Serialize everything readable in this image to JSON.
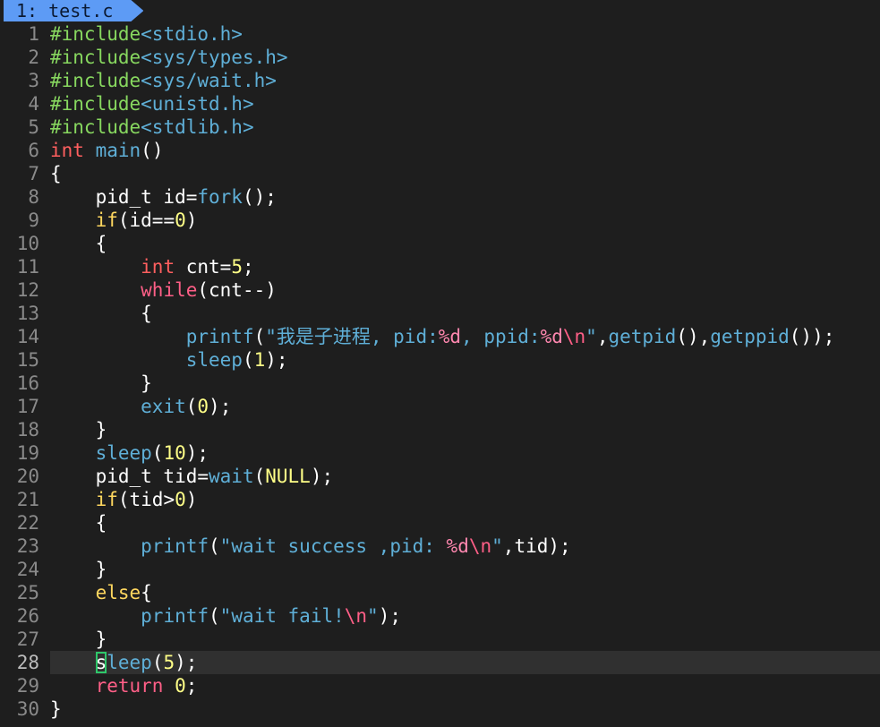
{
  "tab": {
    "number": "1:",
    "filename": "test.c"
  },
  "cursor_line": 28,
  "lines": [
    {
      "n": "1",
      "tokens": [
        {
          "t": "#include",
          "c": "pre"
        },
        {
          "t": "<stdio.h>",
          "c": "inc"
        }
      ]
    },
    {
      "n": "2",
      "tokens": [
        {
          "t": "#include",
          "c": "pre"
        },
        {
          "t": "<sys/types.h>",
          "c": "inc"
        }
      ]
    },
    {
      "n": "3",
      "tokens": [
        {
          "t": "#include",
          "c": "pre"
        },
        {
          "t": "<sys/wait.h>",
          "c": "inc"
        }
      ]
    },
    {
      "n": "4",
      "tokens": [
        {
          "t": "#include",
          "c": "pre"
        },
        {
          "t": "<unistd.h>",
          "c": "inc"
        }
      ]
    },
    {
      "n": "5",
      "tokens": [
        {
          "t": "#include",
          "c": "pre"
        },
        {
          "t": "<stdlib.h>",
          "c": "inc"
        }
      ]
    },
    {
      "n": "6",
      "tokens": [
        {
          "t": "int",
          "c": "type"
        },
        {
          "t": " ",
          "c": "text"
        },
        {
          "t": "main",
          "c": "func"
        },
        {
          "t": "()",
          "c": "text"
        }
      ]
    },
    {
      "n": "7",
      "tokens": [
        {
          "t": "{",
          "c": "text"
        }
      ]
    },
    {
      "n": "8",
      "tokens": [
        {
          "t": "    pid_t id=",
          "c": "text"
        },
        {
          "t": "fork",
          "c": "func"
        },
        {
          "t": "();",
          "c": "text"
        }
      ]
    },
    {
      "n": "9",
      "tokens": [
        {
          "t": "    ",
          "c": "text"
        },
        {
          "t": "if",
          "c": "kw"
        },
        {
          "t": "(id==",
          "c": "text"
        },
        {
          "t": "0",
          "c": "num"
        },
        {
          "t": ")",
          "c": "text"
        }
      ]
    },
    {
      "n": "10",
      "tokens": [
        {
          "t": "    {",
          "c": "text"
        }
      ]
    },
    {
      "n": "11",
      "tokens": [
        {
          "t": "        ",
          "c": "text"
        },
        {
          "t": "int",
          "c": "type"
        },
        {
          "t": " cnt=",
          "c": "text"
        },
        {
          "t": "5",
          "c": "num"
        },
        {
          "t": ";",
          "c": "text"
        }
      ]
    },
    {
      "n": "12",
      "tokens": [
        {
          "t": "        ",
          "c": "text"
        },
        {
          "t": "while",
          "c": "ret"
        },
        {
          "t": "(cnt--)",
          "c": "text"
        }
      ]
    },
    {
      "n": "13",
      "tokens": [
        {
          "t": "        {",
          "c": "text"
        }
      ]
    },
    {
      "n": "14",
      "tokens": [
        {
          "t": "            ",
          "c": "text"
        },
        {
          "t": "printf",
          "c": "func"
        },
        {
          "t": "(",
          "c": "text"
        },
        {
          "t": "\"我是子进程, pid:",
          "c": "str"
        },
        {
          "t": "%d",
          "c": "fmt"
        },
        {
          "t": ", ppid:",
          "c": "str"
        },
        {
          "t": "%d",
          "c": "fmt"
        },
        {
          "t": "\\n",
          "c": "esc"
        },
        {
          "t": "\"",
          "c": "str"
        },
        {
          "t": ",",
          "c": "text"
        },
        {
          "t": "getpid",
          "c": "func"
        },
        {
          "t": "(),",
          "c": "text"
        },
        {
          "t": "getppid",
          "c": "func"
        },
        {
          "t": "());",
          "c": "text"
        }
      ]
    },
    {
      "n": "15",
      "tokens": [
        {
          "t": "            ",
          "c": "text"
        },
        {
          "t": "sleep",
          "c": "func"
        },
        {
          "t": "(",
          "c": "text"
        },
        {
          "t": "1",
          "c": "num"
        },
        {
          "t": ");",
          "c": "text"
        }
      ]
    },
    {
      "n": "16",
      "tokens": [
        {
          "t": "        }",
          "c": "text"
        }
      ]
    },
    {
      "n": "17",
      "tokens": [
        {
          "t": "        ",
          "c": "text"
        },
        {
          "t": "exit",
          "c": "func"
        },
        {
          "t": "(",
          "c": "text"
        },
        {
          "t": "0",
          "c": "num"
        },
        {
          "t": ");",
          "c": "text"
        }
      ]
    },
    {
      "n": "18",
      "tokens": [
        {
          "t": "    }",
          "c": "text"
        }
      ]
    },
    {
      "n": "19",
      "tokens": [
        {
          "t": "    ",
          "c": "text"
        },
        {
          "t": "sleep",
          "c": "func"
        },
        {
          "t": "(",
          "c": "text"
        },
        {
          "t": "10",
          "c": "num"
        },
        {
          "t": ");",
          "c": "text"
        }
      ]
    },
    {
      "n": "20",
      "tokens": [
        {
          "t": "    pid_t tid=",
          "c": "text"
        },
        {
          "t": "wait",
          "c": "func"
        },
        {
          "t": "(",
          "c": "text"
        },
        {
          "t": "NULL",
          "c": "num"
        },
        {
          "t": ");",
          "c": "text"
        }
      ]
    },
    {
      "n": "21",
      "tokens": [
        {
          "t": "    ",
          "c": "text"
        },
        {
          "t": "if",
          "c": "kw"
        },
        {
          "t": "(tid>",
          "c": "text"
        },
        {
          "t": "0",
          "c": "num"
        },
        {
          "t": ")",
          "c": "text"
        }
      ]
    },
    {
      "n": "22",
      "tokens": [
        {
          "t": "    {",
          "c": "text"
        }
      ]
    },
    {
      "n": "23",
      "tokens": [
        {
          "t": "        ",
          "c": "text"
        },
        {
          "t": "printf",
          "c": "func"
        },
        {
          "t": "(",
          "c": "text"
        },
        {
          "t": "\"wait success ,pid: ",
          "c": "str"
        },
        {
          "t": "%d",
          "c": "fmt"
        },
        {
          "t": "\\n",
          "c": "esc"
        },
        {
          "t": "\"",
          "c": "str"
        },
        {
          "t": ",tid);",
          "c": "text"
        }
      ]
    },
    {
      "n": "24",
      "tokens": [
        {
          "t": "    }",
          "c": "text"
        }
      ]
    },
    {
      "n": "25",
      "tokens": [
        {
          "t": "    ",
          "c": "text"
        },
        {
          "t": "else",
          "c": "kw"
        },
        {
          "t": "{",
          "c": "text"
        }
      ]
    },
    {
      "n": "26",
      "tokens": [
        {
          "t": "        ",
          "c": "text"
        },
        {
          "t": "printf",
          "c": "func"
        },
        {
          "t": "(",
          "c": "text"
        },
        {
          "t": "\"wait fail!",
          "c": "str"
        },
        {
          "t": "\\n",
          "c": "esc"
        },
        {
          "t": "\"",
          "c": "str"
        },
        {
          "t": ");",
          "c": "text"
        }
      ]
    },
    {
      "n": "27",
      "tokens": [
        {
          "t": "    }",
          "c": "text"
        }
      ]
    },
    {
      "n": "28",
      "tokens": [
        {
          "t": "    ",
          "c": "text"
        },
        {
          "t": "s",
          "c": "cursor"
        },
        {
          "t": "leep",
          "c": "func"
        },
        {
          "t": "(",
          "c": "text"
        },
        {
          "t": "5",
          "c": "num"
        },
        {
          "t": ");",
          "c": "text"
        }
      ]
    },
    {
      "n": "29",
      "tokens": [
        {
          "t": "    ",
          "c": "text"
        },
        {
          "t": "return",
          "c": "ret"
        },
        {
          "t": " ",
          "c": "text"
        },
        {
          "t": "0",
          "c": "num"
        },
        {
          "t": ";",
          "c": "text"
        }
      ]
    },
    {
      "n": "30",
      "tokens": [
        {
          "t": "}",
          "c": "text"
        }
      ]
    }
  ]
}
